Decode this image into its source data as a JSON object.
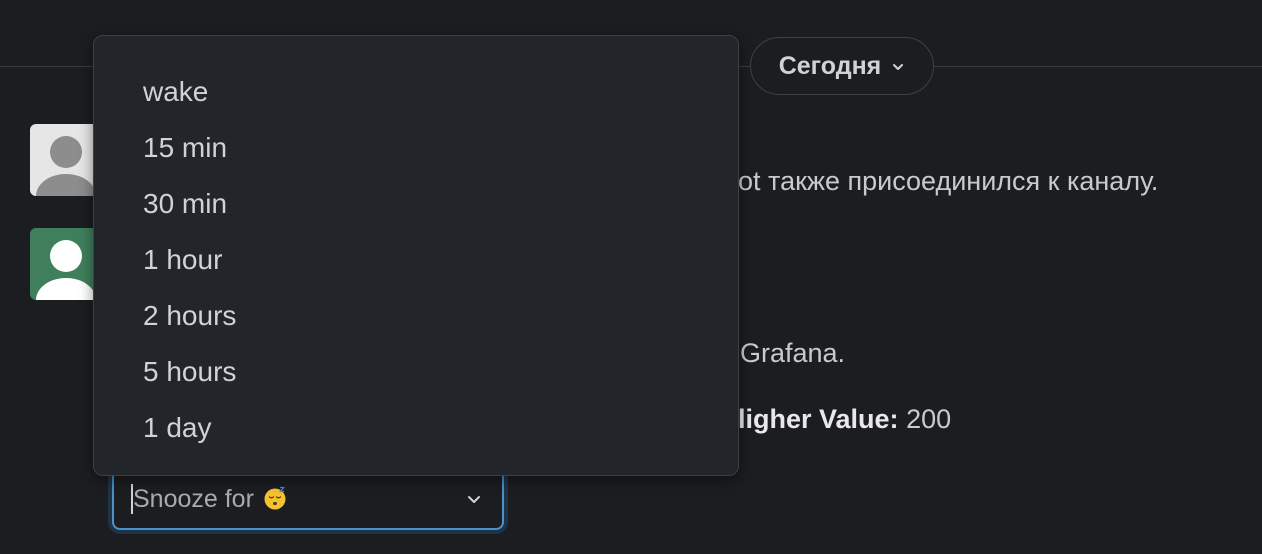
{
  "header": {
    "date_label": "Сегодня"
  },
  "messages": [
    {
      "text": "ot также присоединился к каналу."
    },
    {
      "text": "Grafana."
    },
    {
      "label": "ligher Value:",
      "value": " 200"
    }
  ],
  "snooze": {
    "placeholder": "Snooze for",
    "options": [
      "wake",
      "15 min",
      "30 min",
      "1 hour",
      "2 hours",
      "5 hours",
      "1 day"
    ]
  },
  "colors": {
    "background": "#1b1d21",
    "menu_bg": "#222529",
    "focus_border": "#4a92c8",
    "avatar_green": "#3f7f5b"
  }
}
